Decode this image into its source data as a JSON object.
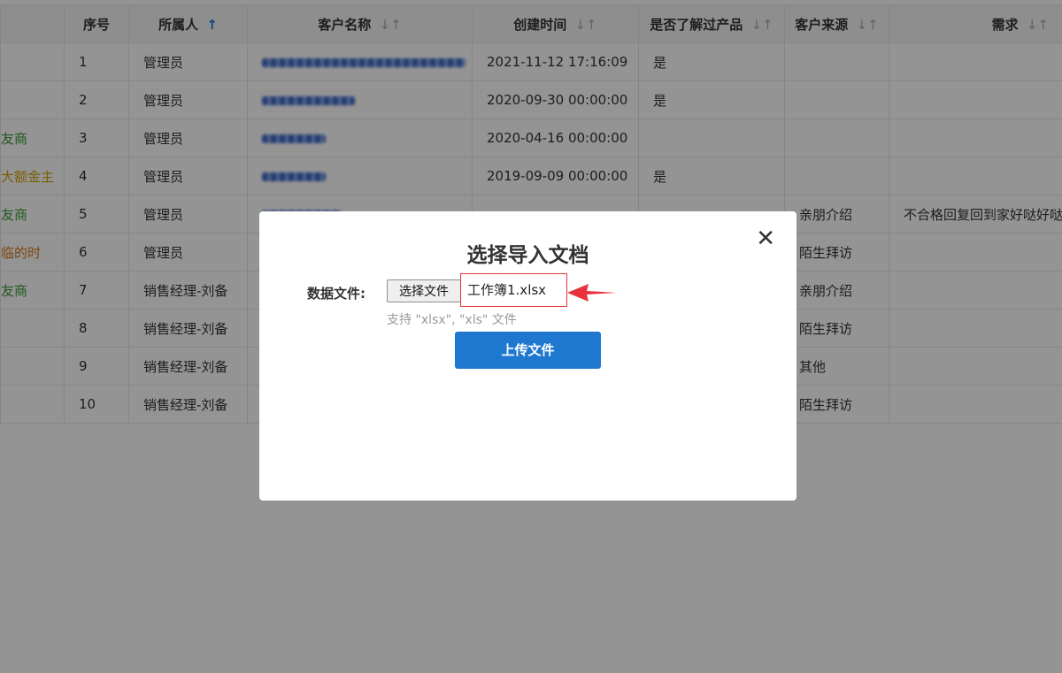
{
  "table": {
    "columns": {
      "index": "序号",
      "owner": "所属人",
      "customer": "客户名称",
      "created": "创建时间",
      "known": "是否了解过产品",
      "source": "客户来源",
      "need": "需求"
    },
    "sort_icons": {
      "owner_active": "↑",
      "inactive": "↓↑"
    },
    "rows": [
      {
        "tag": "",
        "index": "1",
        "owner": "管理员",
        "created": "2021-11-12 17:16:09",
        "known": "是",
        "source": "",
        "need": ""
      },
      {
        "tag": "",
        "index": "2",
        "owner": "管理员",
        "created": "2020-09-30 00:00:00",
        "known": "是",
        "source": "",
        "need": ""
      },
      {
        "tag": "友商",
        "index": "3",
        "owner": "管理员",
        "created": "2020-04-16 00:00:00",
        "known": "",
        "source": "",
        "need": ""
      },
      {
        "tag": "大额金主",
        "index": "4",
        "owner": "管理员",
        "created": "2019-09-09 00:00:00",
        "known": "是",
        "source": "",
        "need": ""
      },
      {
        "tag": "友商",
        "index": "5",
        "owner": "管理员",
        "created": "",
        "known": "",
        "source": "亲朋介绍",
        "need": "不合格回复回到家好哒好哒"
      },
      {
        "tag": "临的时",
        "index": "6",
        "owner": "管理员",
        "created": "",
        "known": "",
        "source": "陌生拜访",
        "need": ""
      },
      {
        "tag": "友商",
        "index": "7",
        "owner": "销售经理-刘备",
        "created": "",
        "known": "",
        "source": "亲朋介绍",
        "need": ""
      },
      {
        "tag": "",
        "index": "8",
        "owner": "销售经理-刘备",
        "created": "",
        "known": "",
        "source": "陌生拜访",
        "need": ""
      },
      {
        "tag": "",
        "index": "9",
        "owner": "销售经理-刘备",
        "created": "",
        "known": "",
        "source": "其他",
        "need": ""
      },
      {
        "tag": "",
        "index": "10",
        "owner": "销售经理-刘备",
        "created": "",
        "known": "",
        "source": "陌生拜访",
        "need": ""
      }
    ]
  },
  "modal": {
    "title": "选择导入文档",
    "close_icon": "close-icon",
    "field_label": "数据文件:",
    "choose_button": "选择文件",
    "file_name": "工作簿1.xlsx",
    "hint": "支持 \"xlsx\", \"xls\" 文件",
    "upload_button": "上传文件"
  },
  "colors": {
    "upload_button": "#1f78cf",
    "highlight_border": "#e8323c",
    "tag_green": "#3a9b3a",
    "tag_gold": "#d4a300",
    "tag_orange": "#d9791f"
  }
}
